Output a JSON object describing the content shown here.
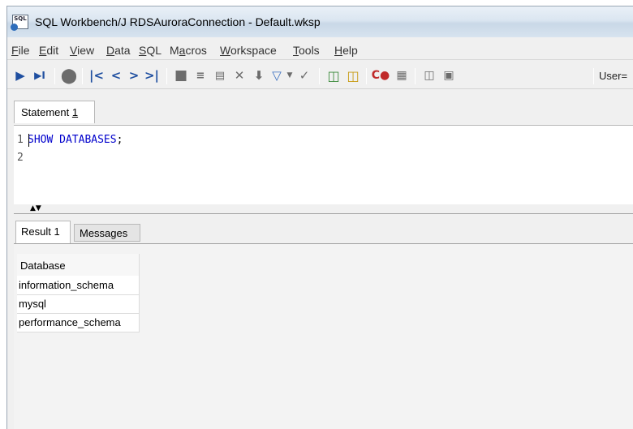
{
  "window": {
    "title": "SQL Workbench/J RDSAuroraConnection - Default.wksp",
    "app_icon": "sql-workbench-icon",
    "app_icon_text": "SQL"
  },
  "menu": [
    {
      "pre": "",
      "ul": "F",
      "post": "ile"
    },
    {
      "pre": "",
      "ul": "E",
      "post": "dit"
    },
    {
      "pre": "",
      "ul": "V",
      "post": "iew"
    },
    {
      "pre": "",
      "ul": "D",
      "post": "ata"
    },
    {
      "pre": "",
      "ul": "S",
      "post": "QL"
    },
    {
      "pre": "M",
      "ul": "a",
      "post": "cros"
    },
    {
      "pre": "",
      "ul": "W",
      "post": "orkspace"
    },
    {
      "pre": "",
      "ul": "T",
      "post": "ools"
    },
    {
      "pre": "",
      "ul": "H",
      "post": "elp"
    }
  ],
  "toolbar": {
    "icons": [
      "execute-current-icon",
      "execute-selected-icon",
      "stop-icon",
      "first-icon",
      "previous-icon",
      "next-icon",
      "last-icon",
      "save-icon",
      "insert-row-icon",
      "copy-row-icon",
      "delete-row-icon",
      "commit-icon",
      "filter-icon",
      "filter-dropdown-icon",
      "remove-filter-icon",
      "database-icon",
      "database-explorer-icon",
      "rollback-icon",
      "table-icon",
      "data-icon",
      "window-icon"
    ],
    "user_label": "User=",
    "colors": {
      "accent": "#1f4fa0",
      "gray": "#6c6c6c",
      "green": "#3b8a3b",
      "red": "#c02a2a"
    }
  },
  "statement_tab": {
    "label": "Statement ",
    "number": "1"
  },
  "editor": {
    "lines": [
      "1",
      "2"
    ],
    "keyword_text": "SHOW DATABASES",
    "terminator": ";",
    "keyword_color": "#0000cc"
  },
  "result_tabs": {
    "result": "Result 1",
    "messages": "Messages"
  },
  "results": {
    "columns": [
      "Database"
    ],
    "rows": [
      "information_schema",
      "mysql",
      "performance_schema"
    ]
  }
}
